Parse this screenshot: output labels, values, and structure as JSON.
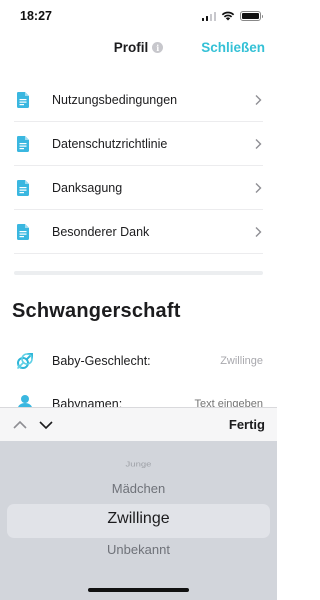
{
  "status_bar": {
    "time": "18:27"
  },
  "nav": {
    "title": "Profil",
    "info_glyph": "i",
    "close_label": "Schließen"
  },
  "menu": {
    "items": [
      {
        "label": "Nutzungsbedingungen",
        "icon": "document-icon"
      },
      {
        "label": "Datenschutzrichtlinie",
        "icon": "document-icon"
      },
      {
        "label": "Danksagung",
        "icon": "document-icon"
      },
      {
        "label": "Besonderer Dank",
        "icon": "document-icon"
      }
    ]
  },
  "pregnancy": {
    "title": "Schwangerschaft",
    "baby_gender": {
      "label": "Baby-Geschlecht:",
      "value": "Zwillinge"
    },
    "baby_names": {
      "label": "Babynamen:",
      "placeholder": "Text eingeben"
    }
  },
  "toolbar": {
    "done_label": "Fertig"
  },
  "picker": {
    "options": [
      "Junge",
      "Mädchen",
      "Zwillinge",
      "Unbekannt"
    ],
    "selected": "Zwillinge"
  },
  "colors": {
    "accent": "#35c1d6",
    "icon_blue": "#3ab7e0",
    "gender_icon": "#2fb6d8"
  }
}
